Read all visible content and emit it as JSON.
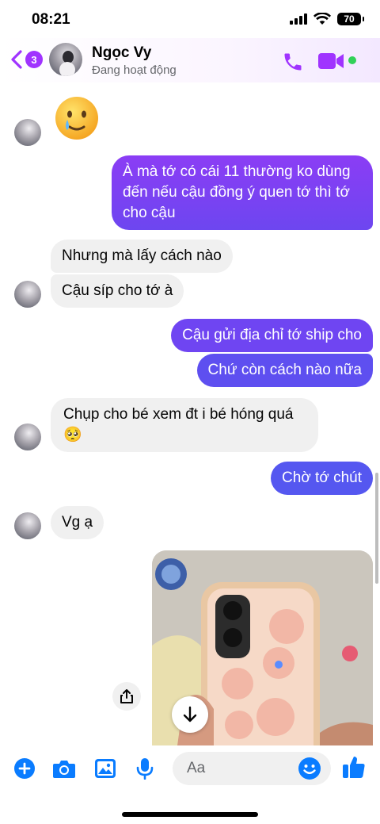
{
  "status_bar": {
    "time": "08:21",
    "battery": "70"
  },
  "header": {
    "back_badge": "3",
    "contact_name": "Ngọc Vy",
    "presence": "Đang hoạt động",
    "icons": [
      "chevron-left-icon",
      "phone-icon",
      "video-camera-icon"
    ],
    "accent_color": "#a033ff",
    "online_color": "#31d158"
  },
  "messages": [
    {
      "from": "them",
      "type": "emoji",
      "content": "🥲"
    },
    {
      "from": "me",
      "text": "À mà tớ có cái 11 thường ko dùng đến nếu cậu đồng ý quen tớ thì tớ cho cậu"
    },
    {
      "from": "them",
      "text": "Nhưng mà lấy cách nào"
    },
    {
      "from": "them",
      "text": "Cậu síp cho tớ à"
    },
    {
      "from": "me",
      "text": "Cậu gửi địa chỉ tớ ship cho"
    },
    {
      "from": "me",
      "text": "Chứ còn cách nào nữa"
    },
    {
      "from": "them",
      "text": "Chụp cho bé xem đt i bé hóng quá 🥺"
    },
    {
      "from": "me",
      "text": "Chờ tớ chút"
    },
    {
      "from": "them",
      "text": "Vg ạ"
    },
    {
      "from": "me",
      "type": "photo"
    }
  ],
  "composer": {
    "placeholder": "Aa",
    "icons": [
      "plus-circle-icon",
      "camera-icon",
      "image-icon",
      "microphone-icon",
      "emoji-icon",
      "thumbs-up-icon"
    ],
    "accent_color": "#0a7cff"
  },
  "colors": {
    "outgoing_bubble": "#7b3cf5",
    "incoming_bubble": "#f0f0f0"
  }
}
